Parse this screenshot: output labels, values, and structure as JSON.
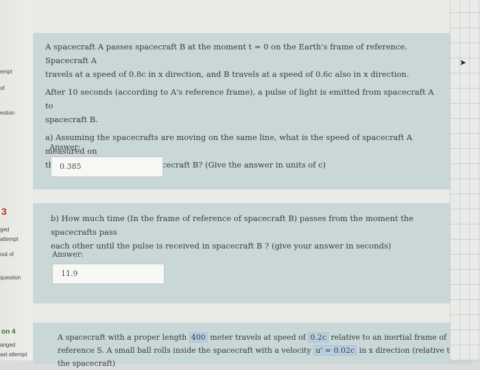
{
  "sidebar": {
    "q_labels": [
      "empt",
      "of",
      "estion"
    ],
    "q3": {
      "number": "3",
      "status": "ged",
      "attempt": "attempt",
      "out_of": "out of",
      "flag": "question"
    },
    "q4": {
      "number": "on 4",
      "status": "anged",
      "attempt": "ast attempt"
    }
  },
  "question2": {
    "text_line1": "A spacecraft A passes spacecraft B at the moment t = 0 on the Earth's frame of reference. Spacecraft A",
    "text_line2": "travels at a speed of 0.8c in x direction, and B travels at a speed of 0.6c also in x direction.",
    "text_line3": "After  10 seconds (according to A's reference frame), a pulse of light is emitted from spacecraft A to",
    "text_line4": "spacecraft B.",
    "part_a_line1": "a) Assuming the spacecrafts are moving on the same line, what is the speed of  spacecraft A measured on",
    "part_a_line2": "the frame of reference of spacecraft B? (Give the answer in units of c)",
    "answer_label": "Answer:",
    "answer_value": "0.385"
  },
  "question3": {
    "part_b_line1": "b) How much time (In the frame of reference of spacecraft B) passes from the moment the spacecrafts pass",
    "part_b_line2": "each other until the pulse is received in spacecraft B ? (give your answer in seconds)",
    "answer_label": "Answer:",
    "answer_value": "11.9"
  },
  "question4": {
    "line1_a": "A spacecraft with a proper length",
    "length_value": "400",
    "line1_b": "meter travels at speed of",
    "speed_value": "0.2c",
    "line1_c": "relative to an inertial frame of",
    "line2_a": "reference S. A small ball rolls inside the spacecraft with a velocity",
    "velocity_value": "u' = 0.02c",
    "line2_b": "in x direction (relative to",
    "line3": "the spacecraft)"
  }
}
